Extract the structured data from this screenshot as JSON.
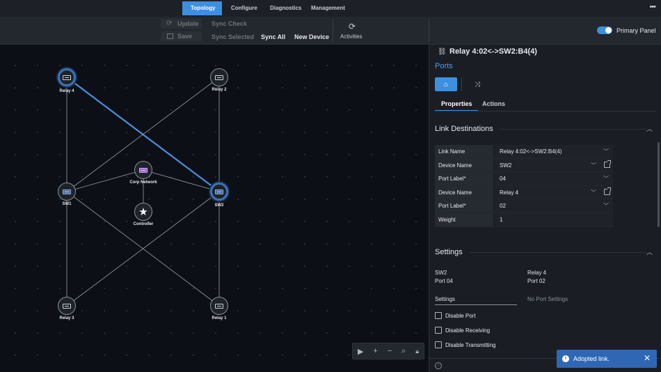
{
  "topnav": {
    "tabs": [
      {
        "label": "Topology",
        "active": true
      },
      {
        "label": "Configure",
        "active": false
      },
      {
        "label": "Diagnostics",
        "active": false
      },
      {
        "label": "Management",
        "active": false
      }
    ],
    "more_icon": "more-horizontal-icon"
  },
  "toolbar": {
    "update": "Update",
    "save": "Save",
    "sync_check": "Sync Check",
    "sync_selected": "Sync Selected",
    "sync_all": "Sync All",
    "new_device": "New Device",
    "activities": "Activities",
    "primary_panel": "Primary Panel",
    "primary_panel_on": true
  },
  "topology": {
    "nodes": [
      {
        "id": "relay4",
        "label": "Relay 4",
        "kind": "relay",
        "selected": true
      },
      {
        "id": "relay2",
        "label": "Relay 2",
        "kind": "relay",
        "selected": false
      },
      {
        "id": "corp",
        "label": "Corp Network",
        "kind": "network",
        "selected": false
      },
      {
        "id": "sw1",
        "label": "SW1",
        "kind": "switch",
        "selected": false
      },
      {
        "id": "sw2",
        "label": "SW2",
        "kind": "switch",
        "selected": true
      },
      {
        "id": "controller",
        "label": "Controller",
        "kind": "controller",
        "selected": false
      },
      {
        "id": "relay3",
        "label": "Relay 3",
        "kind": "relay",
        "selected": false
      },
      {
        "id": "relay1",
        "label": "Relay 1",
        "kind": "relay",
        "selected": false
      }
    ],
    "links": [
      {
        "from": "relay4",
        "to": "sw2",
        "selected": true
      },
      {
        "from": "relay4",
        "to": "sw1",
        "selected": false
      },
      {
        "from": "relay2",
        "to": "sw1",
        "selected": false
      },
      {
        "from": "relay2",
        "to": "sw2",
        "selected": false
      },
      {
        "from": "sw1",
        "to": "corp",
        "selected": false
      },
      {
        "from": "sw2",
        "to": "corp",
        "selected": false
      },
      {
        "from": "corp",
        "to": "controller",
        "selected": false
      },
      {
        "from": "sw1",
        "to": "relay3",
        "selected": false
      },
      {
        "from": "sw1",
        "to": "relay1",
        "selected": false
      },
      {
        "from": "sw2",
        "to": "relay3",
        "selected": false
      },
      {
        "from": "sw2",
        "to": "relay1",
        "selected": false
      }
    ],
    "colors": {
      "selected_link": "#4a8fe0",
      "link": "#9aa0a8"
    }
  },
  "canvas_controls": [
    "play-icon",
    "zoom-in-icon",
    "zoom-out-icon",
    "zoom-fit-icon",
    "lock-icon"
  ],
  "panel": {
    "title": "Relay 4:02<->SW2:B4(4)",
    "ports_label": "Ports",
    "subtabs": [
      "Properties",
      "Actions"
    ],
    "link_destinations": {
      "title": "Link Destinations",
      "rows": [
        {
          "key": "Link Name",
          "value": "Relay 4:02<->SW2:B4(4)"
        },
        {
          "key": "Device Name",
          "value": "SW2"
        },
        {
          "key": "Port Label*",
          "value": "04"
        },
        {
          "key": "Device Name",
          "value": "Relay 4"
        },
        {
          "key": "Port Label*",
          "value": "02"
        },
        {
          "key": "Weight",
          "value": "1"
        }
      ]
    },
    "settings": {
      "title": "Settings",
      "left_device": "SW2",
      "left_port": "Port 04",
      "right_device": "Relay 4",
      "right_port": "Port 02",
      "settings_tab": "Settings",
      "no_port_settings": "No Port Settings",
      "checkboxes": [
        "Disable Port",
        "Disable Receiving",
        "Disable Transmitting"
      ]
    }
  },
  "toast": {
    "message": "Adopted link.",
    "color": "#2f67b5"
  }
}
